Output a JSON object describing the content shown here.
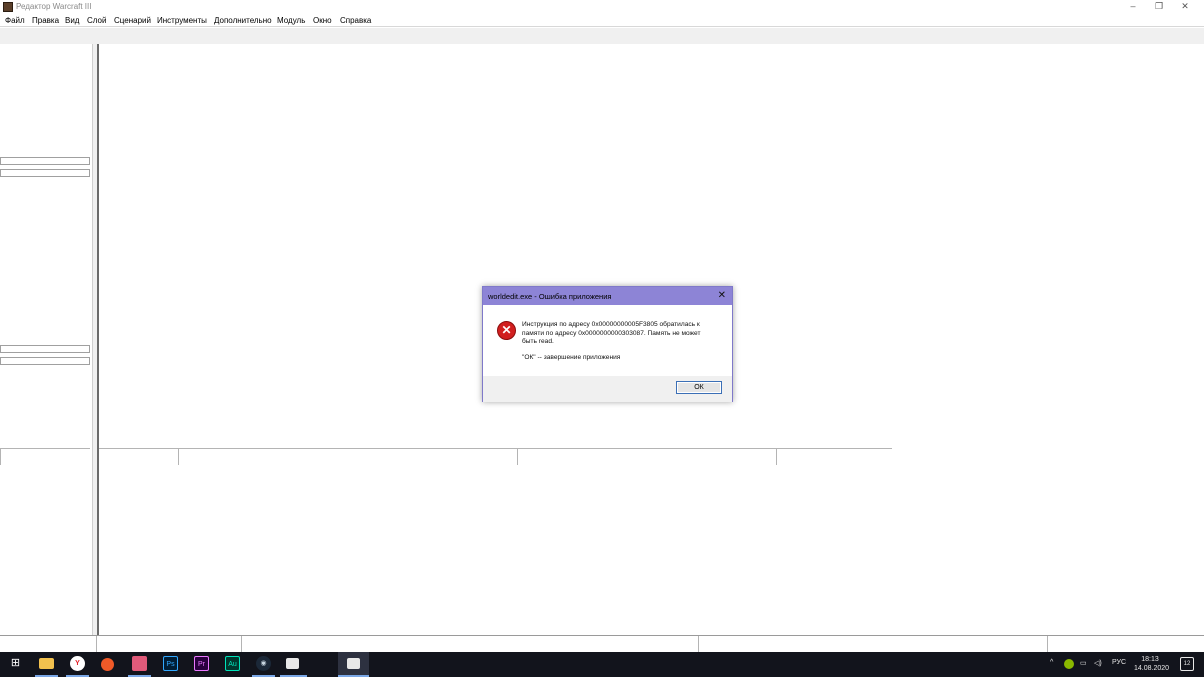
{
  "window": {
    "title": "Редактор Warcraft III",
    "controls": {
      "minimize": "–",
      "restore": "❐",
      "close": "✕"
    }
  },
  "menu": {
    "items": [
      "Файл",
      "Правка",
      "Вид",
      "Слой",
      "Сценарий",
      "Инструменты",
      "Дополнительно",
      "Модуль",
      "Окно",
      "Справка"
    ]
  },
  "dialog": {
    "title": "worldedit.exe - Ошибка приложения",
    "close_symbol": "✕",
    "icon": "error-icon",
    "message_line1": "Инструкция по адресу 0x00000000005F3805 обратилась к",
    "message_line2": "памяти по адресу 0x0000000000303087. Память не может",
    "message_line3": "быть read.",
    "hint": "\"ОК\" -- завершение приложения",
    "ok_label": "ОК"
  },
  "taskbar": {
    "apps": [
      {
        "name": "windows-start-icon",
        "label": "",
        "color": "#ffffff"
      },
      {
        "name": "file-explorer-icon",
        "label": "",
        "color": "#f2c14e"
      },
      {
        "name": "yandex-browser-icon",
        "label": "Y",
        "color": "#ffffff"
      },
      {
        "name": "media-app-icon",
        "label": "",
        "color": "#f05a28"
      },
      {
        "name": "messaging-app-icon",
        "label": "",
        "color": "#e05a7a"
      },
      {
        "name": "photoshop-icon",
        "label": "Ps",
        "color": "#31a8ff"
      },
      {
        "name": "premiere-icon",
        "label": "Pr",
        "color": "#ea77ff"
      },
      {
        "name": "audition-icon",
        "label": "Au",
        "color": "#00e4bb"
      },
      {
        "name": "steam-icon",
        "label": "",
        "color": "#c7d5e0"
      },
      {
        "name": "generic-window-icon",
        "label": "",
        "color": "#e8e8e8"
      },
      {
        "name": "world-editor-taskbar-icon",
        "label": "",
        "color": "#e8e8e8"
      }
    ],
    "tray": {
      "chevron": "^",
      "language": "РУС",
      "time": "18:13",
      "date": "14.08.2020",
      "notifications": "12"
    }
  }
}
